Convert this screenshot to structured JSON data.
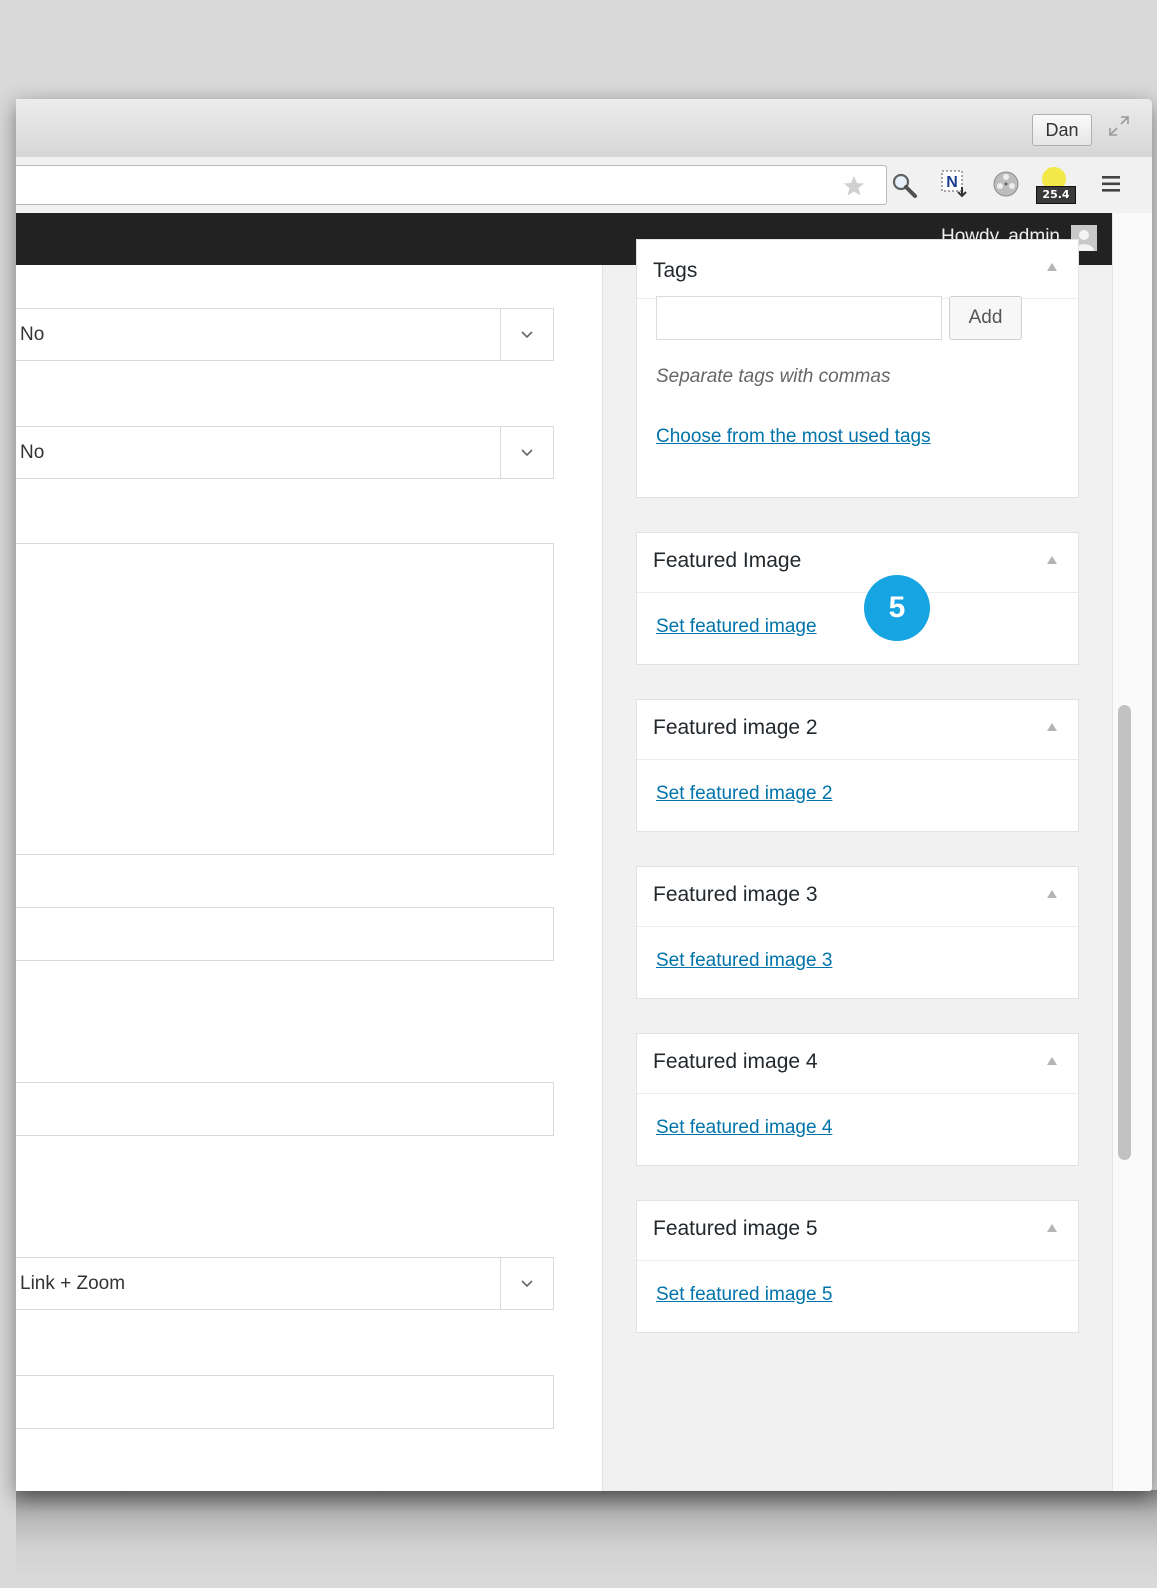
{
  "browser": {
    "profile_name": "Dan",
    "extension_badge": "25.4"
  },
  "admin_bar": {
    "greeting": "Howdy, admin"
  },
  "main_form": {
    "select_1_value": "No",
    "select_2_value": "No",
    "select_3_value": "Link + Zoom",
    "textarea_value": "",
    "text_field_1_value": "",
    "text_field_2_value": "",
    "text_field_3_value": ""
  },
  "sidebar": {
    "tags": {
      "title": "Tags",
      "input_value": "",
      "add_button": "Add",
      "hint": "Separate tags with commas",
      "choose_link": "Choose from the most used tags"
    },
    "featured_boxes": [
      {
        "title": "Featured Image",
        "link": "Set featured image"
      },
      {
        "title": "Featured image 2",
        "link": "Set featured image 2"
      },
      {
        "title": "Featured image 3",
        "link": "Set featured image 3"
      },
      {
        "title": "Featured image 4",
        "link": "Set featured image 4"
      },
      {
        "title": "Featured image 5",
        "link": "Set featured image 5"
      }
    ]
  },
  "callout": {
    "step_number": "5",
    "color": "#16a4e3"
  },
  "colors": {
    "admin_bar": "#222222",
    "link": "#0073aa"
  },
  "icons": [
    "star-icon",
    "magnifier-icon",
    "n-extension-icon",
    "film-reel-icon",
    "sun-extension-icon",
    "menu-icon",
    "fullscreen-icon",
    "chevron-down-icon",
    "triangle-up-icon",
    "avatar"
  ]
}
